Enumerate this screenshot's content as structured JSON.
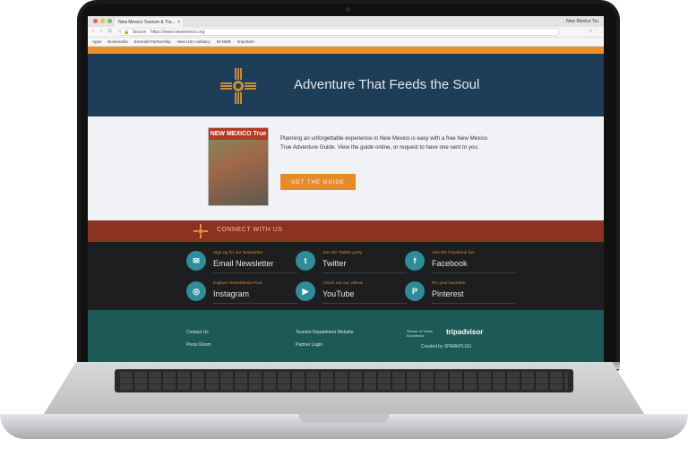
{
  "browser": {
    "tab_title": "New Mexico Tourism & Tra...",
    "tab_close": "×",
    "user_chip": "New Mexico Tru",
    "nav_icons": "‹ › C ⌂",
    "url_prefix": "Secure",
    "url": "https://www.newmexico.org",
    "addr_right": "☆ ⋮",
    "bookmarks": [
      "Apps",
      "Bookmarks",
      "Emerald Partnership",
      "New USA Jubilacy",
      "NI-NMB",
      "Important"
    ]
  },
  "hero": {
    "title": "Adventure That Feeds the Soul",
    "accent_color": "#c98a3a"
  },
  "promo": {
    "cover_title": "NEW MEXICO True",
    "text": "Planning an unforgettable experience in New Mexico is easy with a free New Mexico True Adventure Guide. View the guide online, or request to have one sent to you.",
    "button_label": "GET THE GUIDE"
  },
  "connect": {
    "title": "CONNECT WITH US"
  },
  "social": [
    {
      "icon": "email-icon",
      "glyph": "✉",
      "small": "Sign up for our Newsletter",
      "big": "Email Newsletter"
    },
    {
      "icon": "twitter-icon",
      "glyph": "t",
      "small": "Join the Twitter party",
      "big": "Twitter"
    },
    {
      "icon": "facebook-icon",
      "glyph": "f",
      "small": "Join the Facebook fun",
      "big": "Facebook"
    },
    {
      "icon": "instagram-icon",
      "glyph": "◎",
      "small": "Explore #NewMexicoTrue",
      "big": "Instagram"
    },
    {
      "icon": "youtube-icon",
      "glyph": "▶",
      "small": "Check out our videos",
      "big": "YouTube"
    },
    {
      "icon": "pinterest-icon",
      "glyph": "P",
      "small": "Pin your favorites",
      "big": "Pinterest"
    }
  ],
  "footer": {
    "links_col1": [
      "Contact Us",
      "Press Room"
    ],
    "links_col2": [
      "Tourism Department Website",
      "Partner Login"
    ],
    "trip_pre": "Winner of Travel Excellence",
    "tripadvisor": "tripadvisor",
    "made_by": "Created by SPARKPLUG"
  }
}
